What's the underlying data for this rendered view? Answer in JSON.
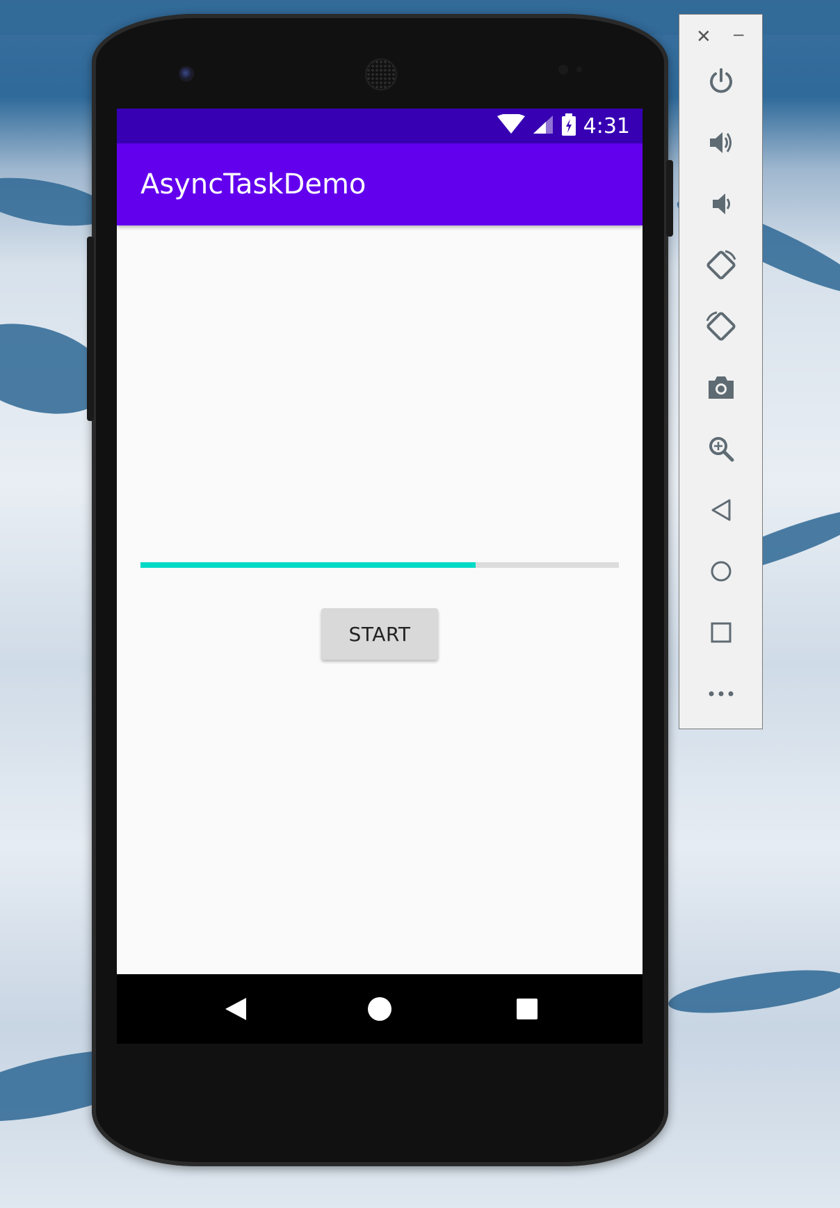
{
  "app": {
    "title": "AsyncTaskDemo",
    "status_time": "4:31",
    "primary_color": "#6200ee",
    "primary_dark": "#3700b3",
    "accent_color": "#03dac5"
  },
  "main": {
    "progress_percent": 70,
    "start_button_label": "START"
  },
  "navigation": {
    "items": [
      "back-icon",
      "home-icon",
      "recents-icon"
    ]
  },
  "emulator_toolbar": {
    "window_controls": [
      "close-icon",
      "minimize-icon"
    ],
    "items": [
      "power-icon",
      "volume-up-icon",
      "volume-down-icon",
      "rotate-left-icon",
      "rotate-right-icon",
      "camera-icon",
      "zoom-icon",
      "back-icon",
      "home-icon",
      "overview-icon",
      "more-icon"
    ],
    "close_glyph": "✕",
    "minimize_glyph": "–"
  }
}
